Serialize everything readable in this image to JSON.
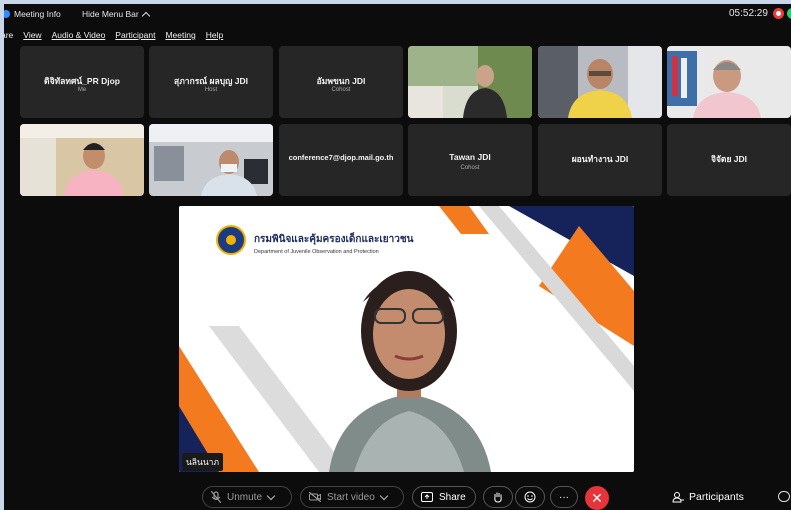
{
  "topbar": {
    "meeting_info": "Meeting Info",
    "hide_menu": "Hide Menu Bar",
    "clock": "05:52:29"
  },
  "menu": [
    "are",
    "View",
    "Audio & Video",
    "Participant",
    "Meeting",
    "Help"
  ],
  "tiles_row1": [
    {
      "name": "ดิจิทัลทศน์_PR Djop",
      "role": "Me"
    },
    {
      "name": "สุภากรณ์ ผลบุญ JDI",
      "role": "Host"
    },
    {
      "name": "อัมพขนก JDI",
      "role": "Cohost"
    }
  ],
  "tiles_row2": [
    {
      "name": "conference7@djop.mail.go.th",
      "role": ""
    },
    {
      "name": "Tawan JDI",
      "role": "Cohost"
    },
    {
      "name": "ผอนทำงาน JDI",
      "role": ""
    },
    {
      "name": "จิจัตย JDI",
      "role": ""
    }
  ],
  "share": {
    "org_th": "กรมพินิจและคุ้มครองเด็กและเยาวชน",
    "org_en": "Department of Juvenile Observation and Protection",
    "speaker": "นลินนาภ"
  },
  "toolbar": {
    "unmute": "Unmute",
    "start_video": "Start video",
    "share": "Share",
    "more": "···",
    "end": "✕",
    "participants": "Participants"
  },
  "colors": {
    "accent": "#2d8cff",
    "end": "#e5343a",
    "orange": "#f47a1f",
    "navy": "#16225a"
  }
}
